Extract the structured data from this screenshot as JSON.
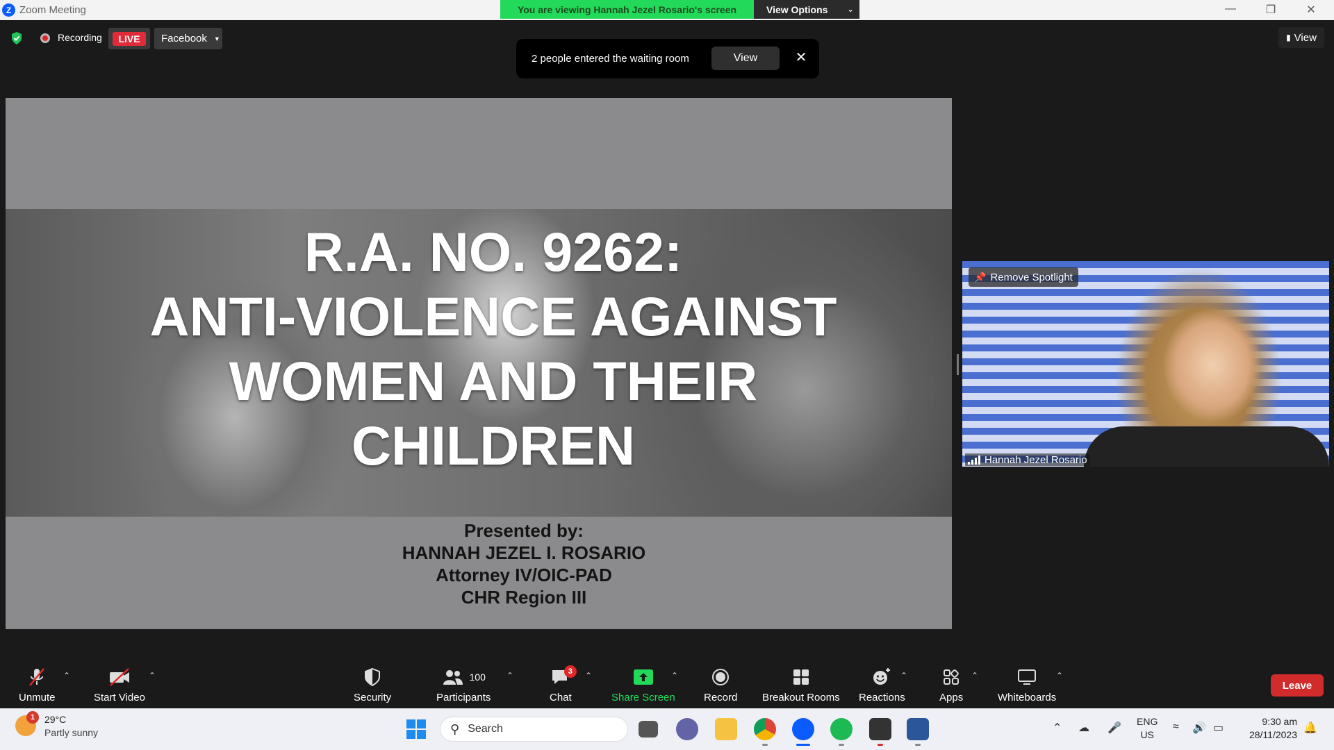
{
  "window": {
    "title": "Zoom Meeting",
    "share_banner": "You are viewing Hannah Jezel Rosario's screen",
    "view_options": "View Options"
  },
  "header": {
    "recording_label": "Recording",
    "live_label": "LIVE",
    "stream_target": "Facebook",
    "view_label": "View"
  },
  "toast": {
    "message": "2 people entered the waiting room",
    "view_label": "View"
  },
  "slide": {
    "title_lines": [
      "R.A. NO. 9262:",
      "ANTI-VIOLENCE AGAINST",
      "WOMEN AND THEIR",
      "CHILDREN"
    ],
    "presented_by": "Presented by:",
    "presenter_name": "HANNAH JEZEL I. ROSARIO",
    "presenter_title": "Attorney IV/OIC-PAD",
    "presenter_org": "CHR Region III"
  },
  "speaker": {
    "spotlight_label": "Remove Spotlight",
    "name": "Hannah Jezel Rosario"
  },
  "toolbar": {
    "unmute": "Unmute",
    "start_video": "Start Video",
    "security": "Security",
    "participants": "Participants",
    "participants_count": "100",
    "chat": "Chat",
    "chat_badge": "3",
    "share_screen": "Share Screen",
    "record": "Record",
    "breakout_rooms": "Breakout Rooms",
    "reactions": "Reactions",
    "apps": "Apps",
    "whiteboards": "Whiteboards",
    "leave": "Leave"
  },
  "taskbar": {
    "weather_temp": "29°C",
    "weather_condition": "Partly sunny",
    "weather_badge": "1",
    "search_label": "Search",
    "lang_top": "ENG",
    "lang_bottom": "US",
    "time": "9:30 am",
    "date": "28/11/2023"
  },
  "colors": {
    "share_green": "#23d959",
    "live_red": "#e02b3b",
    "leave_red": "#d22b2b",
    "zoom_blue": "#0b5cff"
  }
}
